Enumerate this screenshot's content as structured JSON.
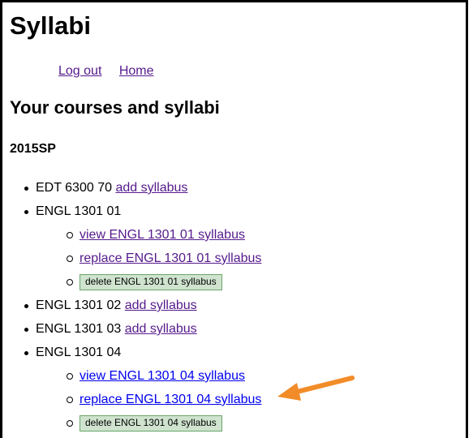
{
  "page": {
    "title": "Syllabi"
  },
  "nav": {
    "logout": "Log out",
    "home": "Home"
  },
  "heading": "Your courses and syllabi",
  "term": "2015SP",
  "courses": [
    {
      "name": "EDT 6300 70",
      "add": "add syllabus"
    },
    {
      "name": "ENGL 1301 01",
      "view": "view ENGL 1301 01 syllabus",
      "replace": "replace ENGL 1301 01 syllabus",
      "delete": "delete ENGL 1301 01 syllabus"
    },
    {
      "name": "ENGL 1301 02",
      "add": "add syllabus"
    },
    {
      "name": "ENGL 1301 03",
      "add": "add syllabus"
    },
    {
      "name": "ENGL 1301 04",
      "view": "view ENGL 1301 04 syllabus",
      "replace": "replace ENGL 1301 04 syllabus",
      "delete": "delete ENGL 1301 04 syllabus"
    }
  ],
  "colors": {
    "arrow": "#f28c28",
    "visited_link": "#551a8b",
    "link": "#0000ee",
    "button_bg": "#cfe3cf"
  },
  "annotation": {
    "icon": "arrow-left-icon"
  }
}
